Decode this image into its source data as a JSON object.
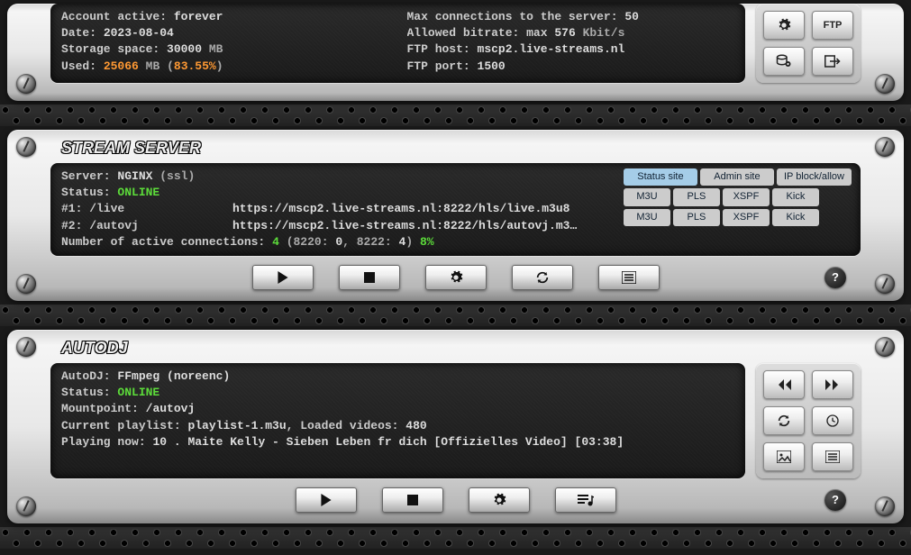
{
  "account": {
    "active_label": "Account active:",
    "active_value": "forever",
    "date_label": "Date:",
    "date_value": "2023-08-04",
    "storage_label": "Storage space:",
    "storage_value": "30000",
    "storage_unit": "MB",
    "used_label": "Used:",
    "used_value": "25066",
    "used_unit": "MB",
    "used_pct": "83.55%",
    "maxconn_label": "Max connections to the server:",
    "maxconn_value": "50",
    "bitrate_label": "Allowed bitrate: max",
    "bitrate_value": "576",
    "bitrate_unit": "Kbit/s",
    "ftphost_label": "FTP host:",
    "ftphost_value": "mscp2.live-streams.nl",
    "ftpport_label": "FTP port:",
    "ftpport_value": "1500",
    "ftp_btn": "FTP"
  },
  "stream": {
    "title": "STREAM SERVER",
    "server_label": "Server:",
    "server_value": "NGINX",
    "server_extra": "(ssl)",
    "status_label": "Status:",
    "status_value": "ONLINE",
    "mount1_label": "#1: /live",
    "mount1_url": "https://mscp2.live-streams.nl:8222/hls/live.m3u8",
    "mount2_label": "#2: /autovj",
    "mount2_url": "https://mscp2.live-streams.nl:8222/hls/autovj.m3…",
    "conn_label": "Number of active connections:",
    "conn_total": "4",
    "conn_detail": "(8220:",
    "conn_a": "0",
    "conn_detail2": ", 8222:",
    "conn_b": "4",
    "conn_detail3": ")",
    "conn_pct": "8%",
    "pills": {
      "status": "Status site",
      "admin": "Admin site",
      "ipblock": "IP block/allow",
      "m3u": "M3U",
      "pls": "PLS",
      "xspf": "XSPF",
      "kick": "Kick"
    }
  },
  "autodj": {
    "title": "AUTODJ",
    "label": "AutoDJ:",
    "value": "FFmpeg (noreenc)",
    "status_label": "Status:",
    "status_value": "ONLINE",
    "mount_label": "Mountpoint:",
    "mount_value": "/autovj",
    "playlist_label": "Current playlist:",
    "playlist_value": "playlist-1.m3u",
    "loaded_label": ", Loaded videos:",
    "loaded_value": "480",
    "now_label": "Playing now:",
    "now_value": "10 . Maite Kelly - Sieben Leben fr dich [Offizielles Video] [03:38]"
  },
  "icons": {
    "gear": "gear",
    "db": "database",
    "logout": "logout",
    "play": "play",
    "stop": "stop",
    "refresh": "refresh",
    "list": "list",
    "prev": "prev",
    "next": "next",
    "clock": "clock",
    "image": "image",
    "playlist": "playlist",
    "help": "?"
  }
}
